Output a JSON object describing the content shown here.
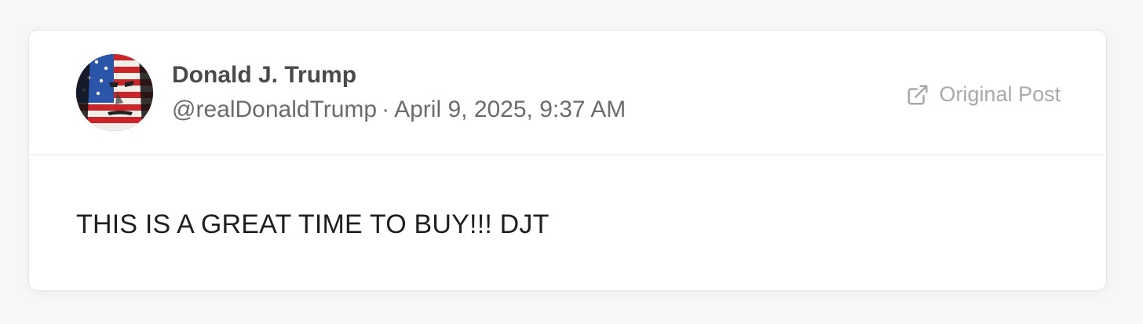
{
  "post": {
    "author_name": "Donald J. Trump",
    "handle": "@realDonaldTrump",
    "separator": "·",
    "timestamp": "April 9, 2025, 9:37 AM",
    "original_post_label": "Original Post",
    "text": "THIS IS A GREAT TIME TO BUY!!! DJT"
  },
  "icons": {
    "avatar": "avatar-flag-portrait",
    "original_post": "external-link-icon"
  },
  "colors": {
    "name": "#4a4a4a",
    "meta": "#6b6b6b",
    "link": "#a9a9a9",
    "text": "#1f1f1f",
    "flag_blue": "#2a55a8",
    "flag_red": "#c8262b"
  }
}
